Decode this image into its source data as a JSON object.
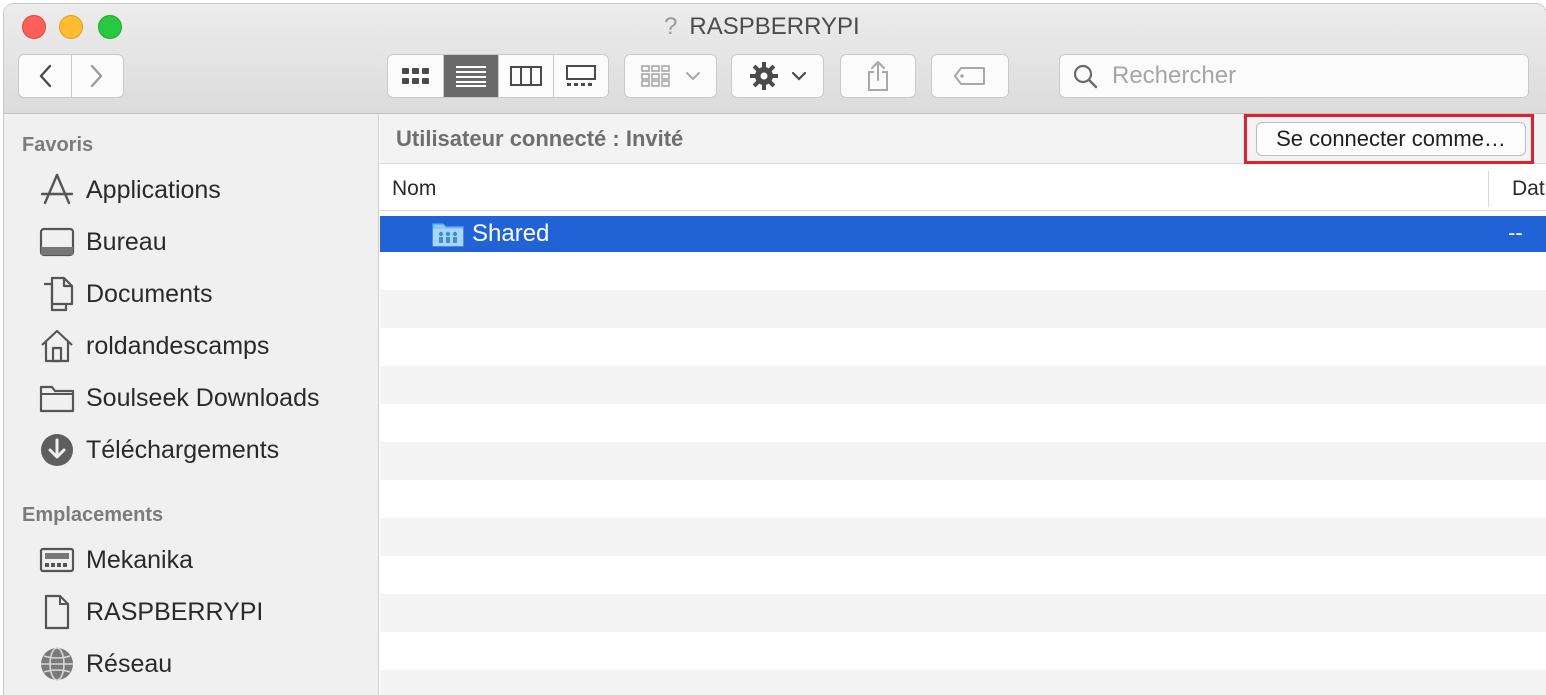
{
  "window": {
    "title": "RASPBERRYPI"
  },
  "toolbar": {
    "search_placeholder": "Rechercher"
  },
  "sidebar": {
    "favorites_header": "Favoris",
    "favorites": [
      {
        "label": "Applications",
        "icon": "applications-icon"
      },
      {
        "label": "Bureau",
        "icon": "desktop-icon"
      },
      {
        "label": "Documents",
        "icon": "documents-icon"
      },
      {
        "label": "roldandescamps",
        "icon": "home-icon"
      },
      {
        "label": "Soulseek Downloads",
        "icon": "folder-icon"
      },
      {
        "label": "Téléchargements",
        "icon": "downloads-icon"
      }
    ],
    "locations_header": "Emplacements",
    "locations": [
      {
        "label": "Mekanika",
        "icon": "computer-icon"
      },
      {
        "label": "RASPBERRYPI",
        "icon": "server-document-icon"
      },
      {
        "label": "Réseau",
        "icon": "network-icon"
      }
    ]
  },
  "main": {
    "connected_user": "Utilisateur connecté : Invité",
    "connect_button": "Se connecter comme…",
    "columns": {
      "name": "Nom",
      "date": "Dat"
    },
    "files": [
      {
        "name": "Shared",
        "date": "--",
        "selected": true
      }
    ]
  },
  "colors": {
    "selection": "#2163d6",
    "highlight_box": "#e0202a"
  }
}
